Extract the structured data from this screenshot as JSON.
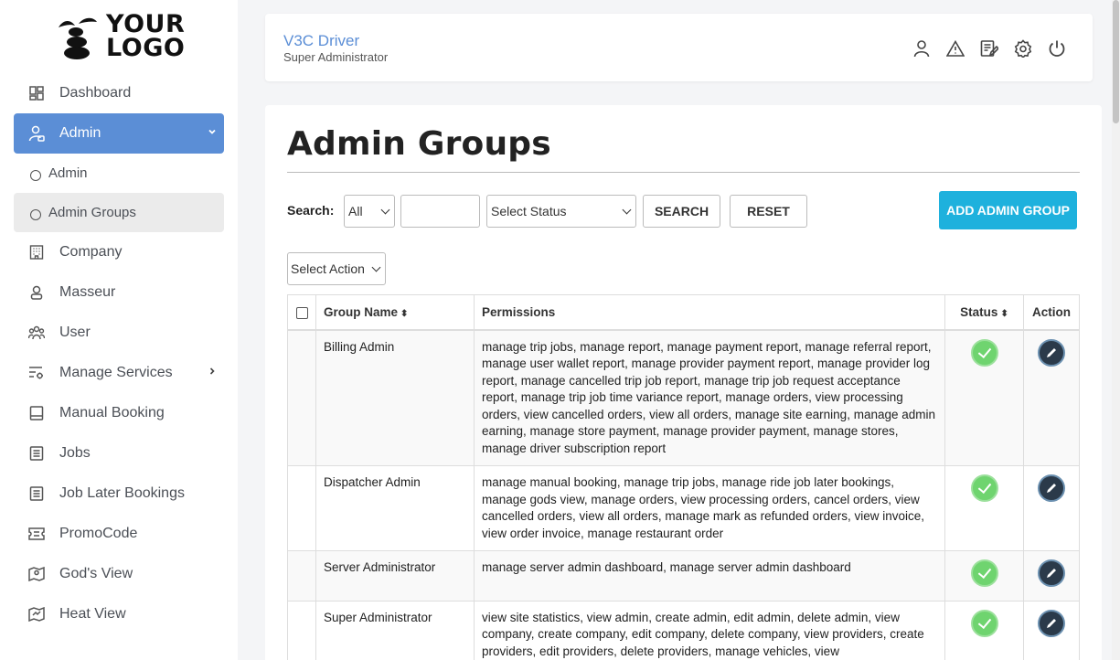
{
  "logo": {
    "line1": "YOUR",
    "line2": "LOGO"
  },
  "sidebar": {
    "items": [
      {
        "label": "Dashboard",
        "icon": "dashboard-icon"
      },
      {
        "label": "Admin",
        "icon": "admin-icon",
        "active": true
      },
      {
        "label": "Admin",
        "sub": true
      },
      {
        "label": "Admin Groups",
        "sub": true,
        "current": true
      },
      {
        "label": "Company",
        "icon": "building-icon"
      },
      {
        "label": "Masseur",
        "icon": "person-icon"
      },
      {
        "label": "User",
        "icon": "users-icon"
      },
      {
        "label": "Manage Services",
        "icon": "services-icon"
      },
      {
        "label": "Manual Booking",
        "icon": "booking-icon"
      },
      {
        "label": "Jobs",
        "icon": "jobs-icon"
      },
      {
        "label": "Job Later Bookings",
        "icon": "list-icon"
      },
      {
        "label": "PromoCode",
        "icon": "ticket-icon"
      },
      {
        "label": "God's View",
        "icon": "map-pin-icon"
      },
      {
        "label": "Heat View",
        "icon": "heat-map-icon"
      }
    ]
  },
  "header": {
    "title": "V3C Driver",
    "subtitle": "Super Administrator",
    "icons": [
      "user-icon",
      "warning-icon",
      "edit-note-icon",
      "settings-icon",
      "power-icon"
    ]
  },
  "page": {
    "title": "Admin Groups",
    "search_label": "Search:",
    "search_field_selected": "All",
    "search_input_value": "",
    "status_select": "Select Status",
    "search_button": "SEARCH",
    "reset_button": "RESET",
    "add_button": "ADD ADMIN GROUP",
    "bulk_action": "Select Action"
  },
  "table": {
    "headers": {
      "name": "Group Name",
      "permissions": "Permissions",
      "status": "Status",
      "action": "Action"
    },
    "rows": [
      {
        "name": "Billing Admin",
        "permissions": "manage trip jobs, manage report, manage payment report, manage referral report, manage user wallet report, manage provider payment report, manage provider log report, manage cancelled trip job report, manage trip job request acceptance report, manage trip job time variance report, manage orders, view processing orders, view cancelled orders, view all orders, manage site earning, manage admin earning, manage store payment, manage provider payment, manage stores, manage driver subscription report",
        "status": "active"
      },
      {
        "name": "Dispatcher Admin",
        "permissions": "manage manual booking, manage trip jobs, manage ride job later bookings, manage gods view, manage orders, view processing orders, cancel orders, view cancelled orders, view all orders, manage mark as refunded orders, view invoice, view order invoice, manage restaurant order",
        "status": "active"
      },
      {
        "name": "Server Administrator",
        "permissions": "manage server admin dashboard, manage server admin dashboard",
        "status": "active"
      },
      {
        "name": "Super Administrator",
        "permissions": "view site statistics, view admin, create admin, edit admin, delete admin, view company, create company, edit company, delete company, view providers, create providers, edit providers, delete providers, manage vehicles, view",
        "status": "active"
      }
    ]
  }
}
